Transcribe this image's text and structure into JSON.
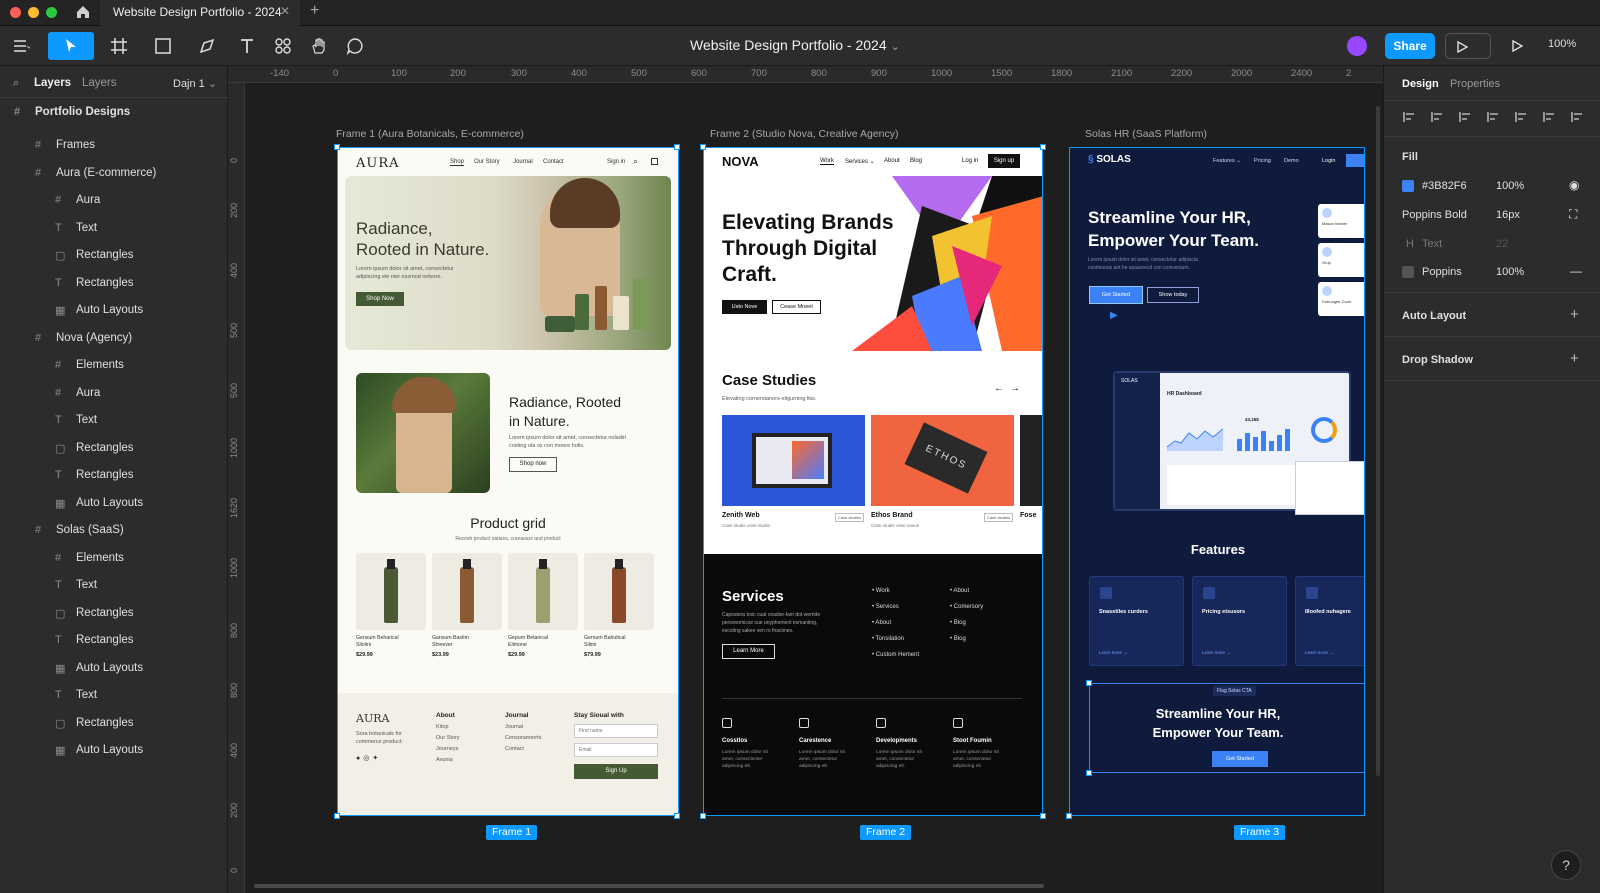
{
  "window": {
    "tab_title": "Website Design Portfolio - 2024",
    "home_icon": "home-icon",
    "new_tab": "+"
  },
  "toolbar": {
    "doc_title": "Website Design Portfolio - 2024",
    "doc_caret": "⌄",
    "share": "Share",
    "zoom": "100%"
  },
  "left_panel": {
    "tabs": [
      "Layers",
      "Layers"
    ],
    "page_select": "Dajn 1",
    "root": "Portfolio Designs",
    "layers": [
      {
        "icon": "frame",
        "label": "Frames"
      },
      {
        "icon": "hash",
        "label": "Aura (E-commerce)"
      },
      {
        "icon": "hash",
        "label": "Aura"
      },
      {
        "icon": "text",
        "label": "Text"
      },
      {
        "icon": "rect",
        "label": "Rectangles"
      },
      {
        "icon": "text",
        "label": "Rectangles"
      },
      {
        "icon": "grid",
        "label": "Auto Layouts"
      },
      {
        "icon": "hash",
        "label": "Nova (Agency)"
      },
      {
        "icon": "hash",
        "label": "Elements"
      },
      {
        "icon": "hash",
        "label": "Aura"
      },
      {
        "icon": "text",
        "label": "Text"
      },
      {
        "icon": "rect",
        "label": "Rectangles"
      },
      {
        "icon": "text",
        "label": "Rectangles"
      },
      {
        "icon": "grid",
        "label": "Auto Layouts"
      },
      {
        "icon": "hash",
        "label": "Solas (SaaS)"
      },
      {
        "icon": "hash",
        "label": "Elements"
      },
      {
        "icon": "text",
        "label": "Text"
      },
      {
        "icon": "rect",
        "label": "Rectangles"
      },
      {
        "icon": "text",
        "label": "Rectangles"
      },
      {
        "icon": "grid",
        "label": "Auto Layouts"
      },
      {
        "icon": "text",
        "label": "Text"
      },
      {
        "icon": "rect",
        "label": "Rectangles"
      },
      {
        "icon": "grid",
        "label": "Auto Layouts"
      }
    ]
  },
  "ruler": {
    "top": [
      "-140",
      "0",
      "100",
      "200",
      "300",
      "400",
      "500",
      "600",
      "700",
      "800",
      "900",
      "1000",
      "1500",
      "1800",
      "2100",
      "2200",
      "2000",
      "2400",
      "2"
    ],
    "left": [
      "0",
      "200",
      "400",
      "500",
      "500",
      "1000",
      "1620",
      "1000",
      "800",
      "800",
      "400",
      "200",
      "0"
    ]
  },
  "frames": [
    {
      "label": "Frame 1 (Aura Botanicals, E-commerce)",
      "badge": "Frame 1"
    },
    {
      "label": "Frame 2 (Studio Nova, Creative Agency)",
      "badge": "Frame 2"
    },
    {
      "label": "Solas HR (SaaS Platform)",
      "badge": "Frame 3"
    }
  ],
  "aura": {
    "logo": "AURA",
    "nav": [
      "Shop",
      "Our Story",
      "Journal",
      "Contact"
    ],
    "signin": "Sign in",
    "hero_title": "Radiance,\nRooted in Nature.",
    "hero_body": "Lorem ipsum dolor sit amet, consectetur\nadipiscing ele nier essmod nolvore.",
    "hero_btn": "Shop Now",
    "sec_title": "Radiance, Rooted\nin Nature.",
    "sec_body": "Lorem ipsum dolor sit amet, consectetur noladirl\ncosting ola os con moere holis.",
    "sec_btn": "Shop now",
    "grid_title": "Product grid",
    "grid_sub": "Recosh product oatians, cranaoars and product",
    "products": [
      {
        "name": "Gensum Beharical\nSilolini",
        "price": "$29.99"
      },
      {
        "name": "Gansum Bastim\nShinever",
        "price": "$23.99"
      },
      {
        "name": "Gepurn Betanical\nElimone",
        "price": "$29.99"
      },
      {
        "name": "Gernum Bahutical\nSilimi",
        "price": "$79.99"
      }
    ],
    "footer_logo": "AURA",
    "footer_desc": "Sora botanicals for\ncommerce product.",
    "col1_title": "About",
    "col1": [
      "Kitop",
      "Our Story",
      "Journeys",
      "Avunia"
    ],
    "col2_title": "Journal",
    "col2": [
      "Journal",
      "Censoramerrts",
      "Contact"
    ],
    "col3_title": "Stay Sioual with",
    "first_ph": "First name",
    "email_ph": "Email",
    "signup": "Sign Up"
  },
  "nova": {
    "logo": "NOVA",
    "nav": [
      "Work",
      "Services ⌄",
      "About",
      "Blog"
    ],
    "login": "Log in",
    "signup": "Sign up",
    "hero": "Elevating Brands\nThrough Digital\nCraft.",
    "btn1": "Usto Nove",
    "btn2": "Cease Mneet",
    "case_title": "Case Studies",
    "case_sub": "Elevating cornerstanors-eligurning lkis.",
    "cases": [
      {
        "name": "Zenith Web",
        "tag": "Case studies",
        "desc": "Case studie onse studie"
      },
      {
        "name": "Ethos Brand",
        "tag": "Case studies",
        "desc": "Case studie onse sauue"
      },
      {
        "name": "Fose",
        "tag": "",
        "desc": ""
      }
    ],
    "services_title": "Services",
    "services_body": "Capostera trsic cuat ceadse-fam dot werride\npersonomicse sue unyphement esmanting,\nescoting sakee ven ro fnacimes.",
    "learn": "Learn More",
    "list1": [
      "Work",
      "Services",
      "About",
      "Tonsilation",
      "Custom Hement"
    ],
    "list2": [
      "About",
      "Comersory",
      "Blog",
      "Blog"
    ],
    "features": [
      {
        "title": "Cosstlos",
        "body": "Lorem ipsum dolor sit\namet, consectecter\nadipiscing elt."
      },
      {
        "title": "Carestence",
        "body": "Lorem ipsum dolor sit\namet, consectetur\nadipiscing elt."
      },
      {
        "title": "Developments",
        "body": "Lorem ipsum dolor sit\namet, consectetur\nadipiscing elt."
      },
      {
        "title": "Stoot Foumin",
        "body": "Lorem ipsum dolor sit\namet, consectetur\nadipiscing elt."
      }
    ]
  },
  "solas": {
    "logo": "SOLAS",
    "nav": [
      "Features ⌄",
      "Pricing",
      "Demo"
    ],
    "login": "Login",
    "hero": "Streamline Your HR,\nEmpower Your Team.",
    "hero_body": "Lorem ipsum dolor sit amet, consectetur adipiscia\ncontinuous ant he asaaorecd con coniversum.",
    "btn1": "Get Started",
    "btn2": "Show today",
    "cards": [
      "Mason Mainer",
      "Grup",
      "Dobuogee Curer"
    ],
    "dash_logo": "SOLAS",
    "dash_title": "HR Dashboard",
    "dash_value": "43,268",
    "features_title": "Features",
    "feats": [
      {
        "title": "Snasstiles curders",
        "link": "Learn more →"
      },
      {
        "title": "Pricing etsusors",
        "link": "Learn more →"
      },
      {
        "title": "Illoofed nuhagere",
        "link": "Learn more →"
      }
    ],
    "cta_tag": "Flag Solas CTA",
    "cta_title": "Streamline Your HR,\nEmpower Your Team.",
    "cta_btn": "Get Started"
  },
  "right_panel": {
    "tabs": [
      "Design",
      "Properties"
    ],
    "fill_title": "Fill",
    "fill_hex": "#3B82F6",
    "fill_opacity": "100%",
    "font": "Poppins Bold",
    "font_size": "16px",
    "h_label": "H",
    "h_value": "Text",
    "h_num": "22",
    "font2": "Poppins",
    "font2_opacity": "100%",
    "auto_layout": "Auto Layout",
    "drop_shadow": "Drop Shadow",
    "help": "?"
  },
  "colors": {
    "accent": "#0d99ff",
    "fill": "#3B82F6",
    "solas_bg": "#0f1b3d",
    "nova_black": "#0a0a0a"
  }
}
